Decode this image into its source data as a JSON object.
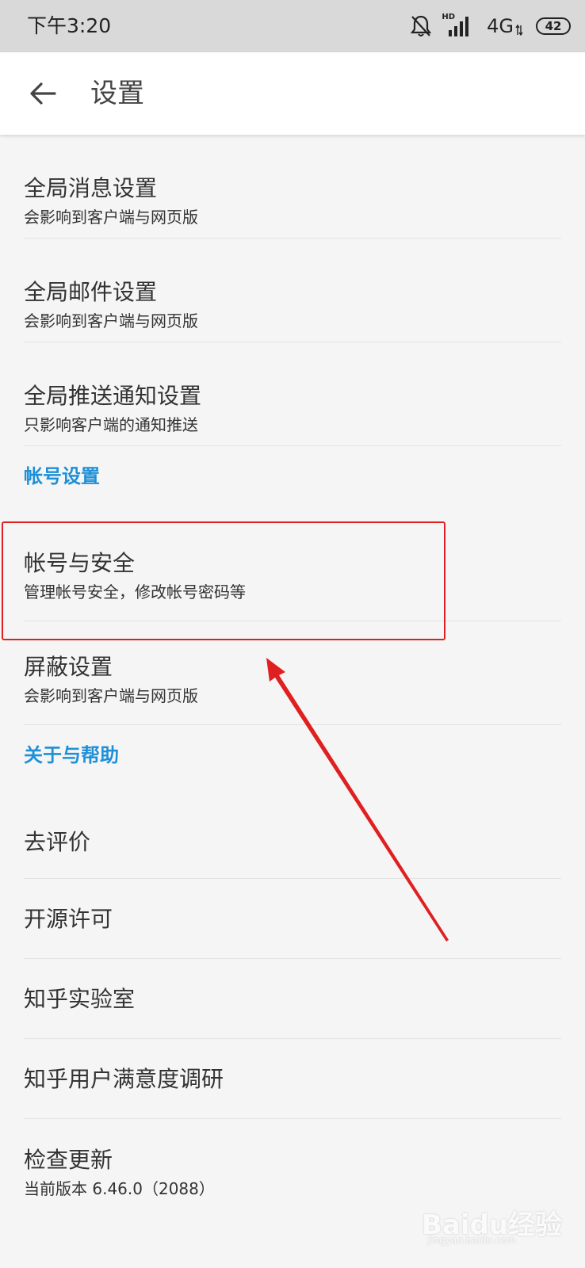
{
  "status_bar": {
    "time": "下午3:20",
    "hd": "HD",
    "network": "4G",
    "battery": "42",
    "icons": [
      "bell-muted-icon",
      "signal-icon",
      "data-arrows-icon",
      "battery-icon"
    ]
  },
  "app_bar": {
    "back_icon": "arrow-left-icon",
    "title": "设置"
  },
  "list": {
    "global_message": {
      "title": "全局消息设置",
      "subtitle": "会影响到客户端与网页版"
    },
    "global_mail": {
      "title": "全局邮件设置",
      "subtitle": "会影响到客户端与网页版"
    },
    "global_push": {
      "title": "全局推送通知设置",
      "subtitle": "只影响客户端的通知推送"
    },
    "section_account": "帐号设置",
    "account_security": {
      "title": "帐号与安全",
      "subtitle": "管理帐号安全，修改帐号密码等"
    },
    "block_settings": {
      "title": "屏蔽设置",
      "subtitle": "会影响到客户端与网页版"
    },
    "section_about": "关于与帮助",
    "rate": {
      "title": "去评价"
    },
    "open_source": {
      "title": "开源许可"
    },
    "lab": {
      "title": "知乎实验室"
    },
    "survey": {
      "title": "知乎用户满意度调研"
    },
    "check_update": {
      "title": "检查更新",
      "subtitle": "当前版本 6.46.0（2088）"
    }
  },
  "colors": {
    "accent": "#1e90d8",
    "annotation": "#e02020",
    "status_bar_bg": "#d9d9d9",
    "background": "#f5f5f5"
  },
  "watermark": {
    "text": "Baidu经验",
    "sub": "jingyan.baidu.com"
  }
}
